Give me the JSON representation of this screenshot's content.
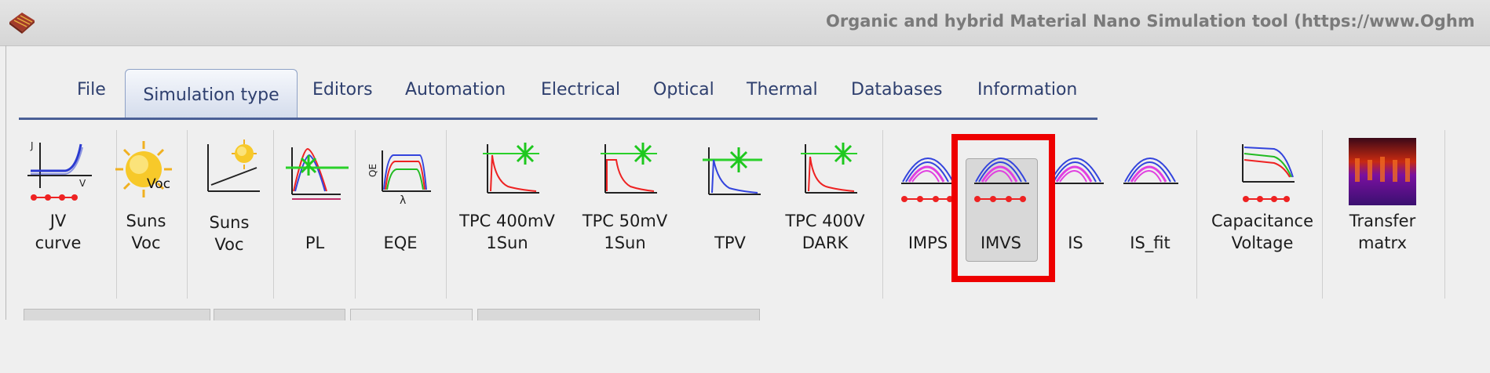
{
  "window": {
    "title": "Organic and hybrid Material Nano Simulation tool (https://www.Oghm"
  },
  "menu_tabs": [
    {
      "label": "File",
      "active": false
    },
    {
      "label": "Simulation type",
      "active": true
    },
    {
      "label": "Editors",
      "active": false
    },
    {
      "label": "Automation",
      "active": false
    },
    {
      "label": "Electrical",
      "active": false
    },
    {
      "label": "Optical",
      "active": false
    },
    {
      "label": "Thermal",
      "active": false
    },
    {
      "label": "Databases",
      "active": false
    },
    {
      "label": "Information",
      "active": false
    }
  ],
  "toolbar": {
    "buttons": [
      {
        "label": "JV\ncurve",
        "icon": "jv-curve-icon"
      },
      {
        "label": "Suns\nVoc",
        "icon": "sun-voc-icon"
      },
      {
        "label": "Suns\nVoc",
        "icon": "suns-voc-plot-icon"
      },
      {
        "label": "PL",
        "icon": "pl-icon"
      },
      {
        "label": "EQE",
        "icon": "eqe-icon"
      },
      {
        "label": "TPC 400mV\n1Sun",
        "icon": "tpc-icon"
      },
      {
        "label": "TPC 50mV\n1Sun",
        "icon": "tpc-icon"
      },
      {
        "label": "TPV",
        "icon": "tpv-icon"
      },
      {
        "label": "TPC 400V\nDARK",
        "icon": "tpc-icon"
      },
      {
        "label": "IMPS",
        "icon": "imps-icon"
      },
      {
        "label": "IMVS",
        "icon": "imvs-icon",
        "pressed": true,
        "highlighted": true
      },
      {
        "label": "IS",
        "icon": "is-icon"
      },
      {
        "label": "IS_fit",
        "icon": "is-fit-icon"
      },
      {
        "label": "Capacitance\nVoltage",
        "icon": "capacitance-voltage-icon"
      },
      {
        "label": "Transfer\nmatrx",
        "icon": "transfer-matrix-icon"
      }
    ],
    "icon_text": {
      "voc": "Voc",
      "jv_j": "J",
      "jv_v": "V",
      "eqe_axis": "QE",
      "eqe_lambda": "λ"
    }
  },
  "colors": {
    "highlight_border": "#ee0000",
    "tab_text": "#2e3f6e",
    "tab_underline": "#4a5f96"
  }
}
